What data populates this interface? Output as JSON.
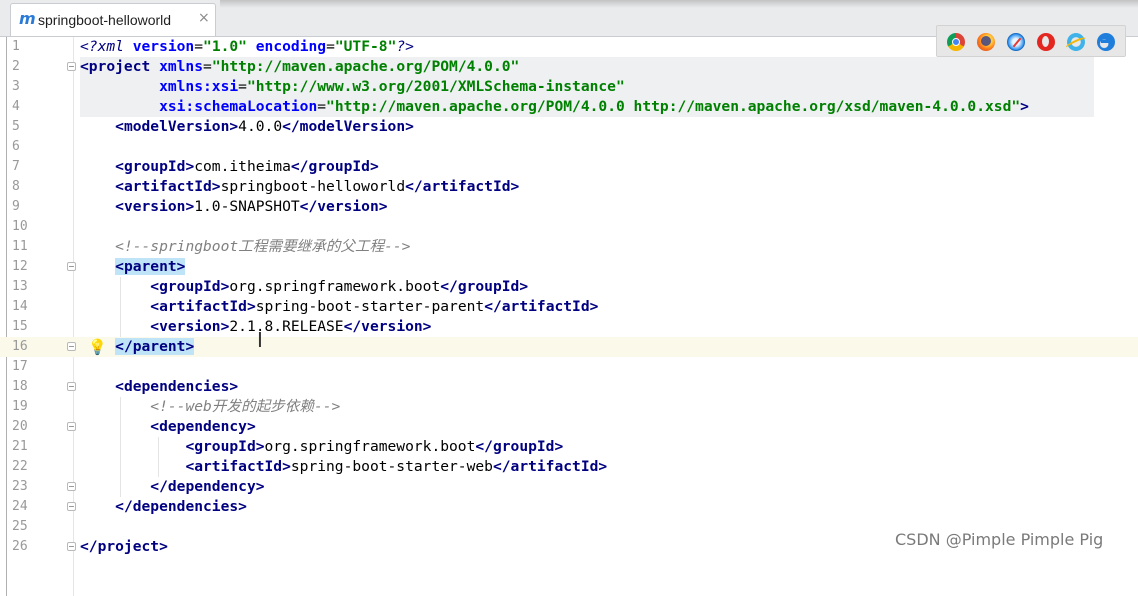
{
  "tab": {
    "icon_glyph": "m",
    "title": "springboot-helloworld",
    "close_glyph": "×"
  },
  "gutter": {
    "line_numbers": [
      "1",
      "2",
      "3",
      "4",
      "5",
      "6",
      "7",
      "8",
      "9",
      "10",
      "11",
      "12",
      "13",
      "14",
      "15",
      "16",
      "17",
      "18",
      "19",
      "20",
      "21",
      "22",
      "23",
      "24",
      "25",
      "26"
    ],
    "bulb_glyph": "💡"
  },
  "code": {
    "l1_a": "<?xml ",
    "l1_b": "version",
    "l1_c": "=",
    "l1_d": "\"1.0\"",
    "l1_e": " ",
    "l1_f": "encoding",
    "l1_g": "=",
    "l1_h": "\"UTF-8\"",
    "l1_i": "?>",
    "l2_a": "<project ",
    "l2_b": "xmlns",
    "l2_c": "=",
    "l2_d": "\"http://maven.apache.org/POM/4.0.0\"",
    "l3_a": "xmlns:xsi",
    "l3_b": "=",
    "l3_c": "\"http://www.w3.org/2001/XMLSchema-instance\"",
    "l4_a": "xsi:schemaLocation",
    "l4_b": "=",
    "l4_c": "\"http://maven.apache.org/POM/4.0.0 http://maven.apache.org/xsd/maven-4.0.0.xsd\"",
    "l4_d": ">",
    "l5_a": "<modelVersion>",
    "l5_b": "4.0.0",
    "l5_c": "</modelVersion>",
    "l7_a": "<groupId>",
    "l7_b": "com.itheima",
    "l7_c": "</groupId>",
    "l8_a": "<artifactId>",
    "l8_b": "springboot-helloworld",
    "l8_c": "</artifactId>",
    "l9_a": "<version>",
    "l9_b": "1.0-SNAPSHOT",
    "l9_c": "</version>",
    "l11": "<!--springboot工程需要继承的父工程-->",
    "l12": "<parent>",
    "l13_a": "<groupId>",
    "l13_b": "org.springframework.boot",
    "l13_c": "</groupId>",
    "l14_a": "<artifactId>",
    "l14_b": "spring-boot-starter-parent",
    "l14_c": "</artifactId>",
    "l15_a": "<version>",
    "l15_b": "2.1.8.RELEASE",
    "l15_c": "</version>",
    "l16": "</parent>",
    "l18": "<dependencies>",
    "l19": "<!--web开发的起步依赖-->",
    "l20": "<dependency>",
    "l21_a": "<groupId>",
    "l21_b": "org.springframework.boot",
    "l21_c": "</groupId>",
    "l22_a": "<artifactId>",
    "l22_b": "spring-boot-starter-web",
    "l22_c": "</artifactId>",
    "l23": "</dependency>",
    "l24": "</dependencies>",
    "l26": "</project>"
  },
  "browsers": [
    "chrome-icon",
    "firefox-icon",
    "safari-icon",
    "opera-icon",
    "ie-icon",
    "edge-icon"
  ],
  "cursor_glyph": "I",
  "watermark": "CSDN @Pimple Pimple Pig",
  "colors": {
    "tag": "#000080",
    "attribute": "#0000ff",
    "value": "#008000",
    "comment": "#808080",
    "current_line": "#fbf9ea",
    "bracket_match": "#bfe4f8"
  }
}
